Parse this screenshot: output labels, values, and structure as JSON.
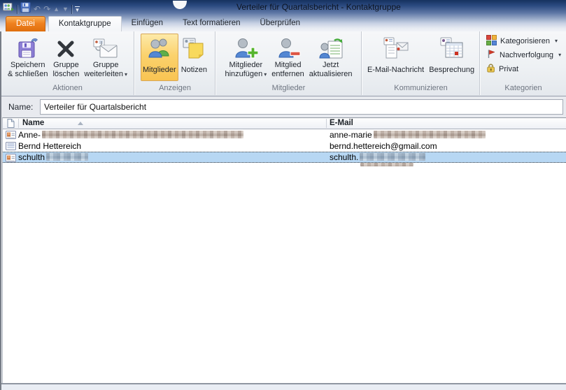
{
  "window": {
    "title": "Verteiler für Quartalsbericht - Kontaktgruppe"
  },
  "icons": {
    "undo": "↶",
    "redo": "↷",
    "previous": "▲",
    "next": "▼",
    "dropdown": "▾"
  },
  "tabs": {
    "file": "Datei",
    "items": [
      {
        "label": "Kontaktgruppe",
        "active": true
      },
      {
        "label": "Einfügen",
        "active": false
      },
      {
        "label": "Text formatieren",
        "active": false
      },
      {
        "label": "Überprüfen",
        "active": false
      }
    ]
  },
  "ribbon": {
    "aktionen": {
      "label": "Aktionen",
      "buttons": [
        {
          "line1": "Speichern",
          "line2": "& schließen"
        },
        {
          "line1": "Gruppe",
          "line2": "löschen"
        },
        {
          "line1": "Gruppe",
          "line2": "weiterleiten",
          "has_dropdown": true
        }
      ]
    },
    "anzeigen": {
      "label": "Anzeigen",
      "buttons": [
        {
          "line1": "Mitglieder",
          "selected": true
        },
        {
          "line1": "Notizen",
          "selected": false
        }
      ]
    },
    "mitglieder": {
      "label": "Mitglieder",
      "buttons": [
        {
          "line1": "Mitglieder",
          "line2": "hinzufügen",
          "has_dropdown": true
        },
        {
          "line1": "Mitglied",
          "line2": "entfernen"
        },
        {
          "line1": "Jetzt",
          "line2": "aktualisieren"
        }
      ]
    },
    "kommunizieren": {
      "label": "Kommunizieren",
      "buttons": [
        {
          "line1": "E-Mail-Nachricht"
        },
        {
          "line1": "Besprechung"
        }
      ]
    },
    "kategorien": {
      "label": "Kategorien",
      "buttons": [
        {
          "label": "Kategorisieren",
          "has_dropdown": true
        },
        {
          "label": "Nachverfolgung",
          "has_dropdown": true
        },
        {
          "label": "Privat"
        }
      ]
    }
  },
  "form": {
    "name_label": "Name:",
    "name_value": "Verteiler für Quartalsbericht"
  },
  "table": {
    "columns": {
      "name": "Name",
      "email": "E-Mail"
    },
    "sort": {
      "column": "Name",
      "direction": "ascending"
    },
    "rows": [
      {
        "name_prefix": "Anne-",
        "name_redacted": true,
        "email_prefix": "anne-marie",
        "email_redacted": true,
        "icon": "contact-card",
        "selected": false
      },
      {
        "name": "Bernd Hettereich",
        "email": "bernd.hettereich@gmail.com",
        "icon": "contact-card-plain",
        "selected": false
      },
      {
        "name_prefix": "schulth",
        "name_redacted": true,
        "email_prefix": "schulth.",
        "email_redacted": true,
        "icon": "contact-card",
        "selected": true
      }
    ]
  },
  "colors": {
    "title_bar_blue": "#16325F",
    "file_tab_orange": "#E8780F",
    "selected_ribbon_button": "#FBD26D",
    "selection_blue": "#B7D7F3"
  }
}
